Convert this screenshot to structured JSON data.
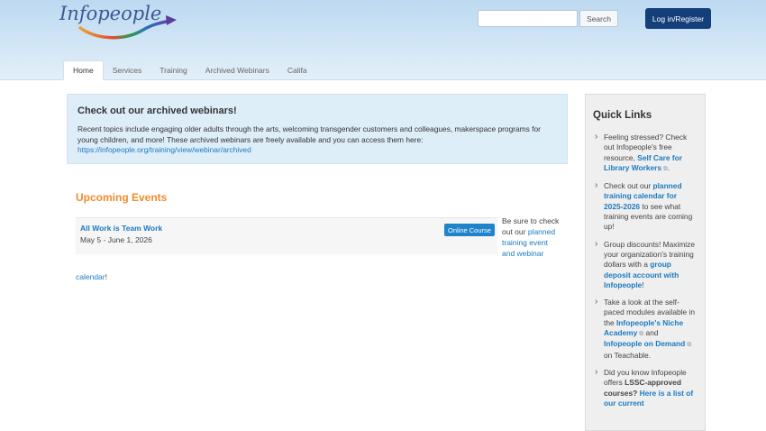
{
  "header": {
    "logo_text": "Infopeople",
    "search": {
      "value": "",
      "placeholder": ""
    },
    "search_label": "Search",
    "login_label": "Log in/Register"
  },
  "nav": {
    "tabs": [
      "Home",
      "Services",
      "Training",
      "Archived Webinars",
      "Califa"
    ]
  },
  "callout": {
    "title": "Check out our archived webinars!",
    "body": "Recent topics include engaging older adults through the arts, welcoming transgender customers and colleagues, makerspace programs for young children, and more! These archived webinars are freely available and you can access them here: ",
    "link": "https://infopeople.org/training/view/webinar/archived"
  },
  "events": {
    "title": "Upcoming Events",
    "items": [
      {
        "name": "All Work is Team Work",
        "date": "May 5 - June 1, 2026",
        "badge": "Online Course"
      }
    ],
    "note_prefix": "Be sure to check out our",
    "note_link": "planned training event and webinar",
    "note_link_tail": "calendar",
    "note_suffix": "!"
  },
  "quick_links": {
    "title": "Quick Links",
    "items": [
      {
        "pre": "Feeling stressed? Check out Infopeople's free resource, ",
        "link": "Self Care for Library Workers",
        "post": "."
      },
      {
        "pre": "Check out our ",
        "link": "planned training calendar for 2025-2026",
        "post": " to see what training events are coming up!"
      },
      {
        "pre": "Group discounts! Maximize your organization's training dollars with a ",
        "link": "group deposit account with Infopeople",
        "post": "!"
      },
      {
        "pre": "Take a look at the self-paced modules available in the ",
        "link": "Infopeople's Niche Academy",
        "mid": " and ",
        "link2": "Infopeople on Demand",
        "post": " on Teachable."
      },
      {
        "pre": "Did you know Infopeople offers ",
        "bold": "LSSC-approved courses?",
        "link": " Here is a list of our current"
      }
    ]
  },
  "colors": {
    "accent_orange": "#f08c2e",
    "link_blue": "#1b7ac2",
    "login_navy": "#143f7a"
  }
}
